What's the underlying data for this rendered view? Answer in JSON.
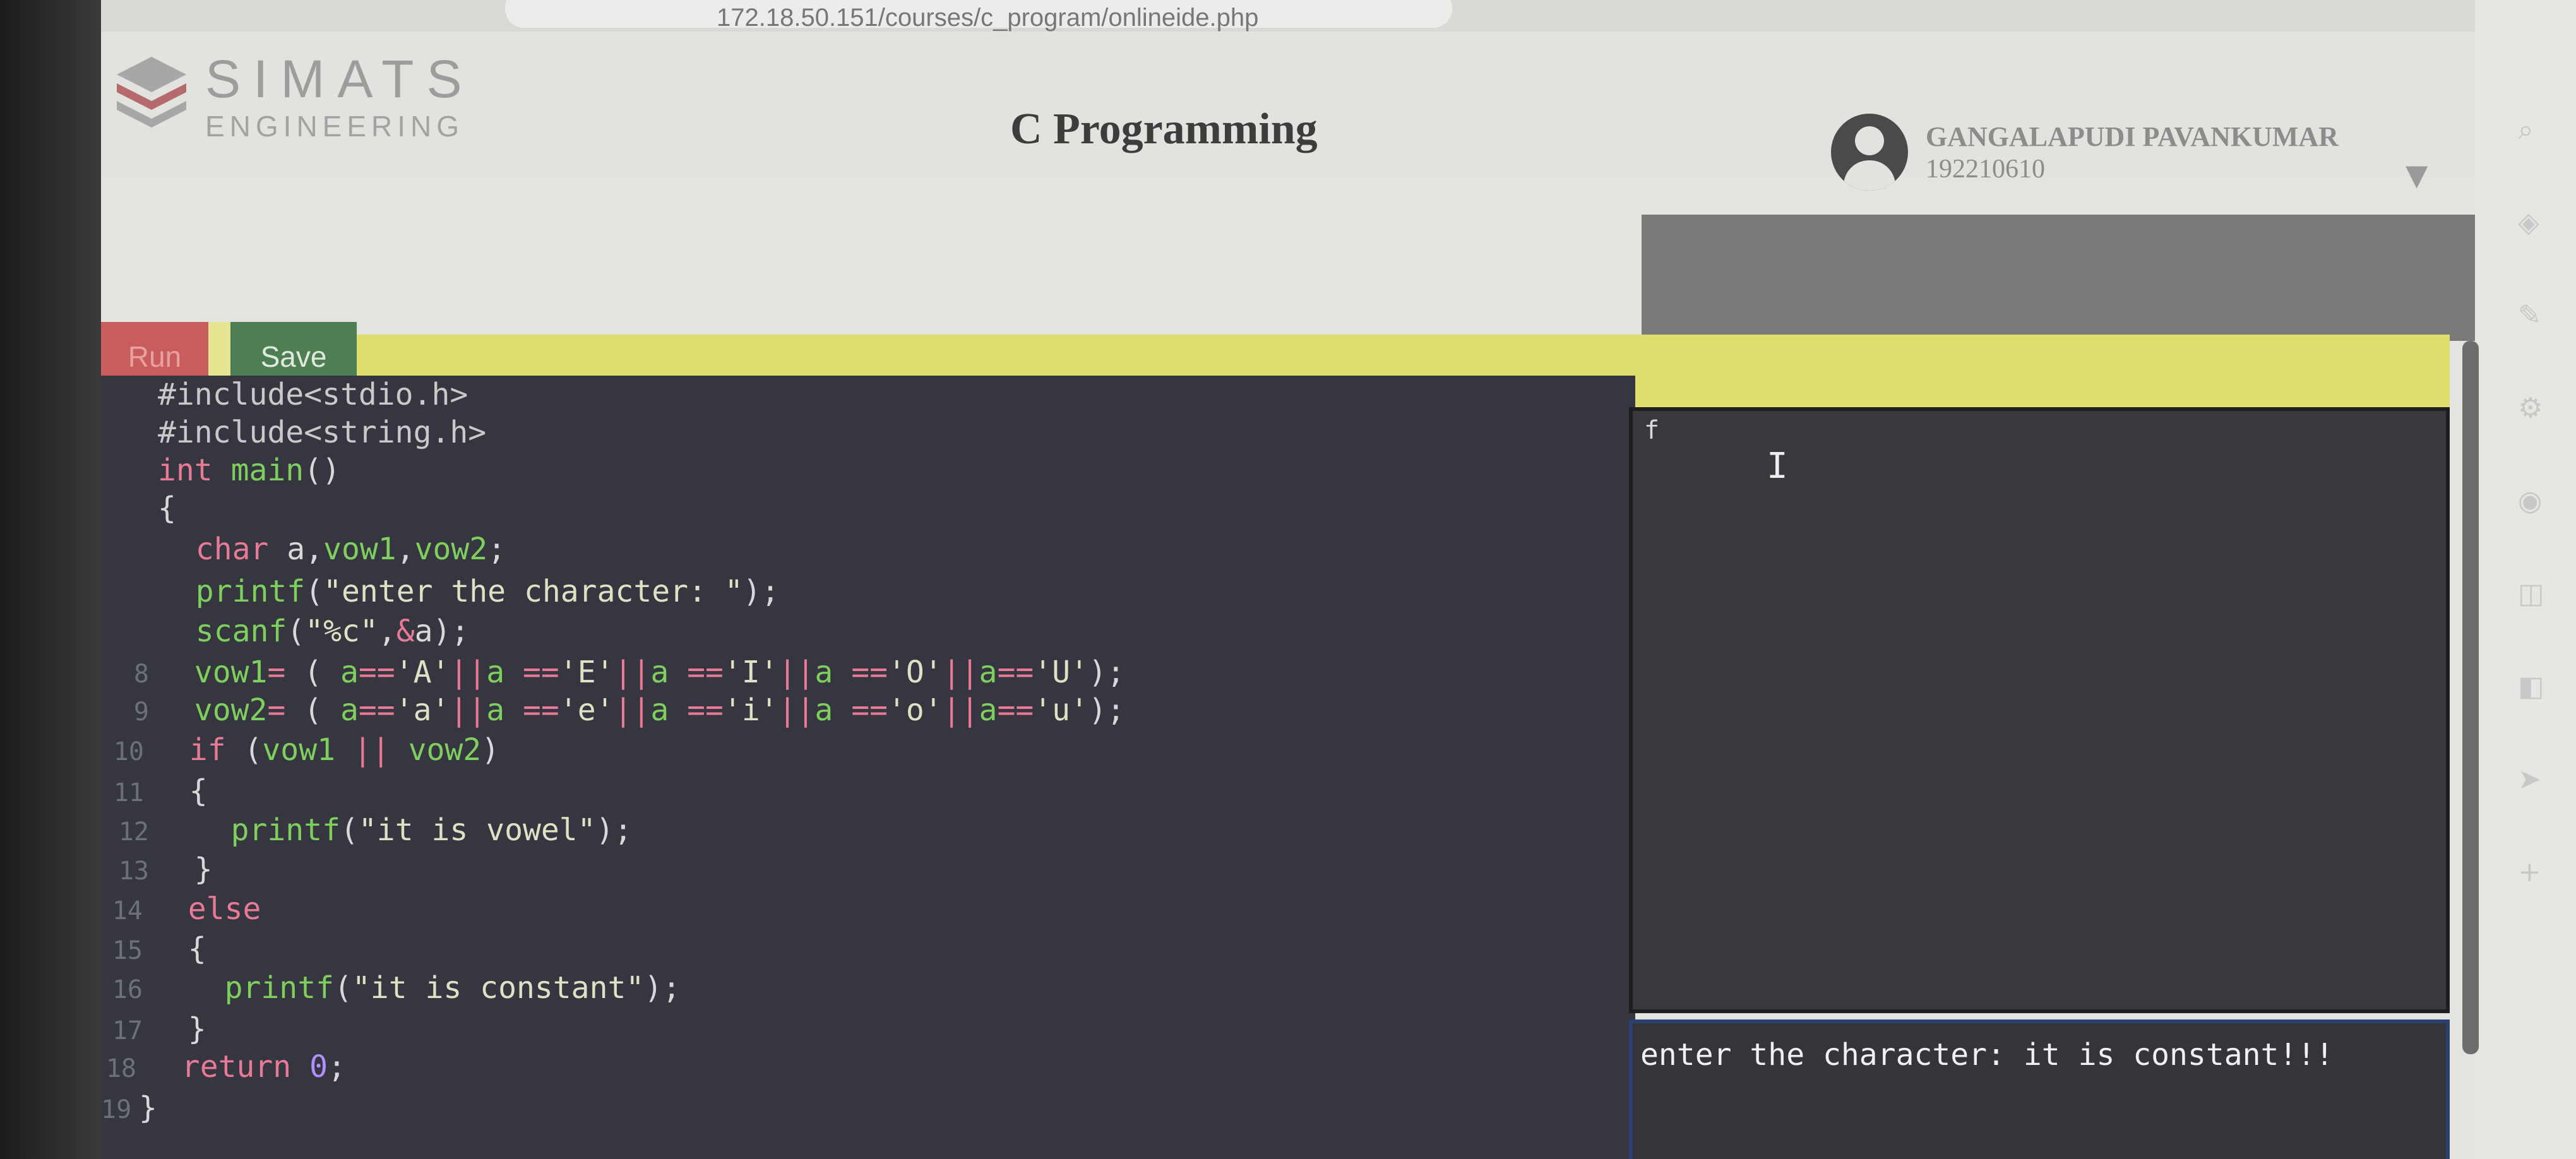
{
  "browser": {
    "url": "172.18.50.151/courses/c_program/onlineide.php",
    "toolbar_icons": [
      "read-aloud-icon",
      "favorite-add-icon",
      "favorites-icon",
      "collections-icon",
      "extensions-icon"
    ],
    "sidebar_icons": [
      "search-icon",
      "shopping-icon",
      "tools-icon",
      "games-icon",
      "office-icon",
      "outlook-icon",
      "word-icon",
      "send-icon",
      "add-icon"
    ]
  },
  "header": {
    "logo_main": "SIMATS",
    "logo_sub": "ENGINEERING",
    "title": "C Programming",
    "user_name": "GANGALAPUDI PAVANKUMAR",
    "user_id": "192210610"
  },
  "toolbar": {
    "run_label": "Run",
    "save_label": "Save"
  },
  "editor": {
    "lines": [
      {
        "n": "",
        "segs": [
          [
            "pre",
            "#include<stdio.h>"
          ]
        ]
      },
      {
        "n": "",
        "segs": [
          [
            "pre",
            "#include<string.h>"
          ]
        ]
      },
      {
        "n": "",
        "segs": [
          [
            "kw",
            "int"
          ],
          [
            "fn",
            " main"
          ],
          [
            "",
            "()"
          ]
        ]
      },
      {
        "n": "",
        "segs": [
          [
            "",
            "{"
          ]
        ]
      },
      {
        "n": "",
        "segs": [
          [
            "",
            "  "
          ],
          [
            "kw",
            "char"
          ],
          [
            "",
            " a,"
          ],
          [
            "fn",
            "vow1"
          ],
          [
            "",
            ","
          ],
          [
            "fn",
            "vow2"
          ],
          [
            "",
            ";"
          ]
        ]
      },
      {
        "n": "",
        "segs": [
          [
            "",
            "  "
          ],
          [
            "fn",
            "printf"
          ],
          [
            "",
            "("
          ],
          [
            "str",
            "\"enter the character: \""
          ],
          [
            "",
            ");"
          ]
        ]
      },
      {
        "n": "",
        "segs": [
          [
            "",
            "  "
          ],
          [
            "fn",
            "scanf"
          ],
          [
            "",
            "("
          ],
          [
            "str",
            "\"%c\""
          ],
          [
            "",
            ","
          ],
          [
            "kw",
            "&"
          ],
          [
            "",
            "a);"
          ]
        ]
      },
      {
        "n": "8",
        "segs": [
          [
            "",
            "  "
          ],
          [
            "fn",
            "vow1"
          ],
          [
            "kw",
            "="
          ],
          [
            "",
            " ( "
          ],
          [
            "fn",
            "a"
          ],
          [
            "kw",
            "=="
          ],
          [
            "str",
            "'A'"
          ],
          [
            "kw",
            "||"
          ],
          [
            "fn",
            "a"
          ],
          [
            "",
            " "
          ],
          [
            "kw",
            "=="
          ],
          [
            "str",
            "'E'"
          ],
          [
            "kw",
            "||"
          ],
          [
            "fn",
            "a"
          ],
          [
            "",
            " "
          ],
          [
            "kw",
            "=="
          ],
          [
            "str",
            "'I'"
          ],
          [
            "kw",
            "||"
          ],
          [
            "fn",
            "a"
          ],
          [
            "",
            " "
          ],
          [
            "kw",
            "=="
          ],
          [
            "str",
            "'O'"
          ],
          [
            "kw",
            "||"
          ],
          [
            "fn",
            "a"
          ],
          [
            "kw",
            "=="
          ],
          [
            "str",
            "'U'"
          ],
          [
            "",
            ");"
          ]
        ]
      },
      {
        "n": "9",
        "segs": [
          [
            "",
            "  "
          ],
          [
            "fn",
            "vow2"
          ],
          [
            "kw",
            "="
          ],
          [
            "",
            " ( "
          ],
          [
            "fn",
            "a"
          ],
          [
            "kw",
            "=="
          ],
          [
            "str",
            "'a'"
          ],
          [
            "kw",
            "||"
          ],
          [
            "fn",
            "a"
          ],
          [
            "",
            " "
          ],
          [
            "kw",
            "=="
          ],
          [
            "str",
            "'e'"
          ],
          [
            "kw",
            "||"
          ],
          [
            "fn",
            "a"
          ],
          [
            "",
            " "
          ],
          [
            "kw",
            "=="
          ],
          [
            "str",
            "'i'"
          ],
          [
            "kw",
            "||"
          ],
          [
            "fn",
            "a"
          ],
          [
            "",
            " "
          ],
          [
            "kw",
            "=="
          ],
          [
            "str",
            "'o'"
          ],
          [
            "kw",
            "||"
          ],
          [
            "fn",
            "a"
          ],
          [
            "kw",
            "=="
          ],
          [
            "str",
            "'u'"
          ],
          [
            "",
            ");"
          ]
        ]
      },
      {
        "n": "10",
        "segs": [
          [
            "",
            "  "
          ],
          [
            "kw",
            "if"
          ],
          [
            "",
            " ("
          ],
          [
            "fn",
            "vow1"
          ],
          [
            "",
            " "
          ],
          [
            "kw",
            "||"
          ],
          [
            "",
            " "
          ],
          [
            "fn",
            "vow2"
          ],
          [
            "",
            ")"
          ]
        ]
      },
      {
        "n": "11",
        "segs": [
          [
            "",
            "  {"
          ]
        ]
      },
      {
        "n": "12",
        "segs": [
          [
            "",
            "    "
          ],
          [
            "fn",
            "printf"
          ],
          [
            "",
            "("
          ],
          [
            "str",
            "\"it is vowel\""
          ],
          [
            "",
            ");"
          ]
        ]
      },
      {
        "n": "13",
        "segs": [
          [
            "",
            "  }"
          ]
        ]
      },
      {
        "n": "14",
        "segs": [
          [
            "",
            "  "
          ],
          [
            "kw",
            "else"
          ]
        ]
      },
      {
        "n": "15",
        "segs": [
          [
            "",
            "  {"
          ]
        ]
      },
      {
        "n": "16",
        "segs": [
          [
            "",
            "    "
          ],
          [
            "fn",
            "printf"
          ],
          [
            "",
            "("
          ],
          [
            "str",
            "\"it is constant\""
          ],
          [
            "",
            ");"
          ]
        ]
      },
      {
        "n": "17",
        "segs": [
          [
            "",
            "  }"
          ]
        ]
      },
      {
        "n": "18",
        "segs": [
          [
            "",
            "  "
          ],
          [
            "kw",
            "return"
          ],
          [
            "",
            " "
          ],
          [
            "num",
            "0"
          ],
          [
            "",
            ";"
          ]
        ]
      },
      {
        "n": "19",
        "segs": [
          [
            "",
            "}"
          ]
        ]
      }
    ]
  },
  "input": {
    "value": "f"
  },
  "output": {
    "text": "enter the character: it is constant!!!"
  },
  "colors": {
    "run": "#c95c5c",
    "save": "#4e7f52",
    "toolbar": "#dede6c",
    "editor_bg": "#35363f",
    "keyword": "#e87a96",
    "function": "#7fcf5e"
  }
}
